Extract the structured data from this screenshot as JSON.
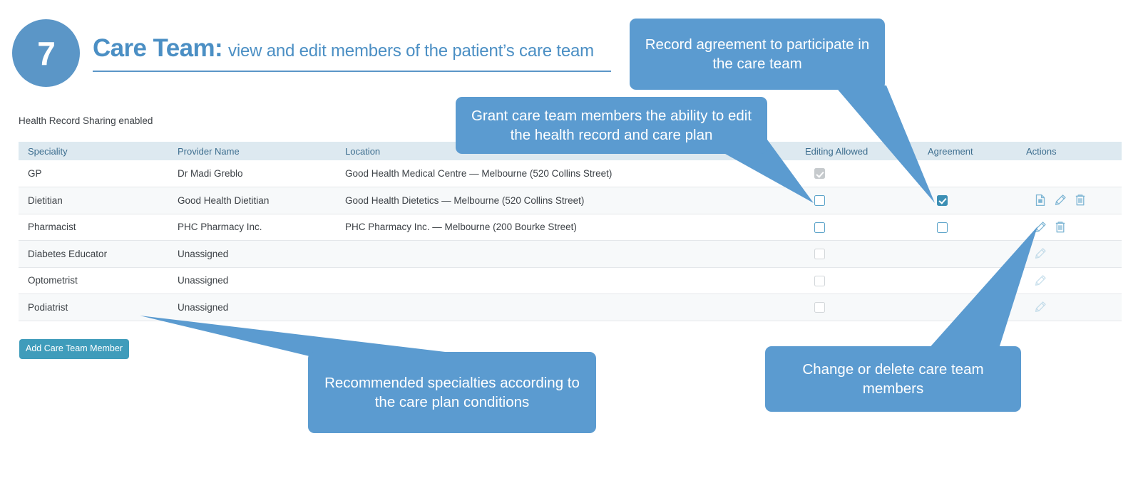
{
  "header": {
    "step_number": "7",
    "title_main": "Care Team:",
    "title_sub": "view and edit members of the patient’s care team"
  },
  "status": {
    "sharing_text": "Health Record Sharing enabled"
  },
  "colors": {
    "accent_blue": "#5b9bd0",
    "title_blue": "#4b8fc4",
    "table_header_bg": "#dde9f0",
    "header_text": "#3d6e8f",
    "button_teal": "#3f9cbb",
    "checkbox_blue": "#5ba3c9",
    "checkbox_checked": "#3c8fb4",
    "row_stripe": "#f7f9fa",
    "disabled_gray": "#c6cacd"
  },
  "table": {
    "columns": [
      {
        "key": "speciality",
        "label": "Speciality"
      },
      {
        "key": "provider",
        "label": "Provider Name"
      },
      {
        "key": "location",
        "label": "Location"
      },
      {
        "key": "editing",
        "label": "Editing Allowed"
      },
      {
        "key": "agreement",
        "label": "Agreement"
      },
      {
        "key": "actions",
        "label": "Actions"
      }
    ],
    "rows": [
      {
        "speciality": "GP",
        "provider": "Dr Madi Greblo",
        "location": "Good Health Medical Centre — Melbourne (520 Collins Street)",
        "editing_state": "disabled-checked",
        "agreement_state": "none",
        "actions": []
      },
      {
        "speciality": "Dietitian",
        "provider": "Good Health Dietitian",
        "location": "Good Health Dietetics — Melbourne (520 Collins Street)",
        "editing_state": "empty",
        "agreement_state": "checked",
        "actions": [
          "document-icon",
          "pencil-icon",
          "trash-icon"
        ]
      },
      {
        "speciality": "Pharmacist",
        "provider": "PHC Pharmacy Inc.",
        "location": "PHC Pharmacy Inc. — Melbourne (200 Bourke Street)",
        "editing_state": "empty",
        "agreement_state": "empty",
        "actions": [
          "pencil-icon",
          "trash-icon"
        ]
      },
      {
        "speciality": "Diabetes Educator",
        "provider": "Unassigned",
        "location": "",
        "editing_state": "disabled-empty",
        "agreement_state": "none",
        "actions": [
          "pencil-icon-faded"
        ]
      },
      {
        "speciality": "Optometrist",
        "provider": "Unassigned",
        "location": "",
        "editing_state": "disabled-empty",
        "agreement_state": "none",
        "actions": [
          "pencil-icon-faded"
        ]
      },
      {
        "speciality": "Podiatrist",
        "provider": "Unassigned",
        "location": "",
        "editing_state": "disabled-empty",
        "agreement_state": "none",
        "actions": [
          "pencil-icon-faded"
        ]
      }
    ]
  },
  "buttons": {
    "add_member": "Add Care Team Member"
  },
  "callouts": {
    "agreement": "Record agreement to participate in the care team",
    "editing": "Grant care team members the ability to edit the health record and care plan",
    "recommended": "Recommended specialties according to the care plan conditions",
    "change_delete": "Change or delete care team members"
  }
}
